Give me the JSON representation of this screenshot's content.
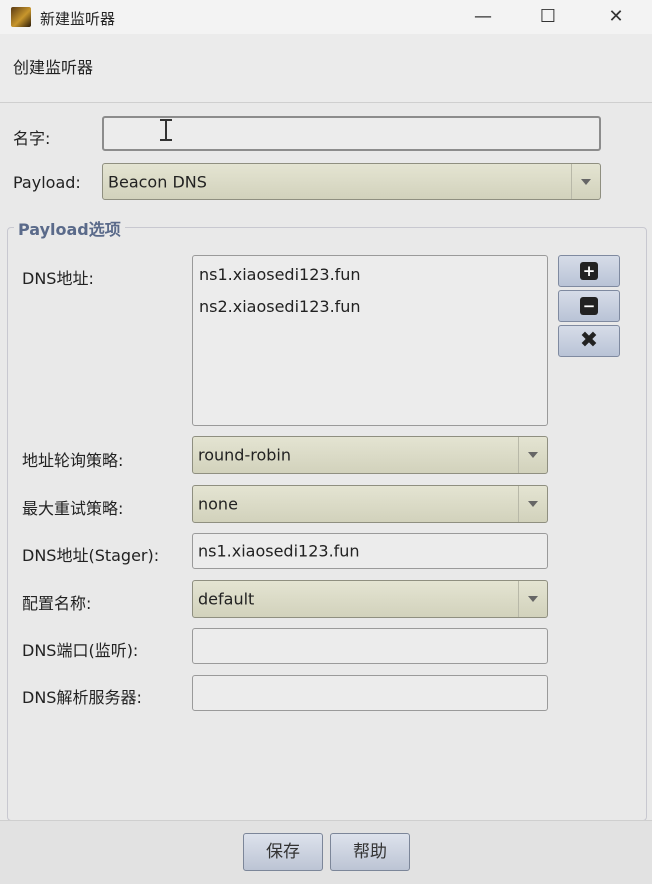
{
  "window": {
    "title": "新建监听器",
    "minimize_glyph": "—",
    "maximize_glyph": "☐",
    "close_glyph": "✕"
  },
  "header": {
    "title": "创建监听器"
  },
  "form": {
    "name_label": "名字:",
    "name_value": "",
    "payload_label": "Payload:",
    "payload_value": "Beacon DNS"
  },
  "options": {
    "group_title": "Payload选项",
    "dns_hosts_label": "DNS地址:",
    "dns_hosts": [
      "ns1.xiaosedi123.fun",
      "ns2.xiaosedi123.fun"
    ],
    "add_glyph": "+",
    "remove_glyph": "−",
    "clear_glyph": "✖",
    "rotation_label": "地址轮询策略:",
    "rotation_value": "round-robin",
    "max_retry_label": "最大重试策略:",
    "max_retry_value": "none",
    "stager_host_label": "DNS地址(Stager):",
    "stager_host_value": "ns1.xiaosedi123.fun",
    "profile_label": "配置名称:",
    "profile_value": "default",
    "dns_port_label": "DNS端口(监听):",
    "dns_port_value": "",
    "dns_resolver_label": "DNS解析服务器:",
    "dns_resolver_value": ""
  },
  "buttons": {
    "save": "保存",
    "help": "帮助"
  },
  "colors": {
    "group_title": "#5a6a8a",
    "combo_bg": "#dcdcc8",
    "button_bg": "#c9d0de"
  }
}
